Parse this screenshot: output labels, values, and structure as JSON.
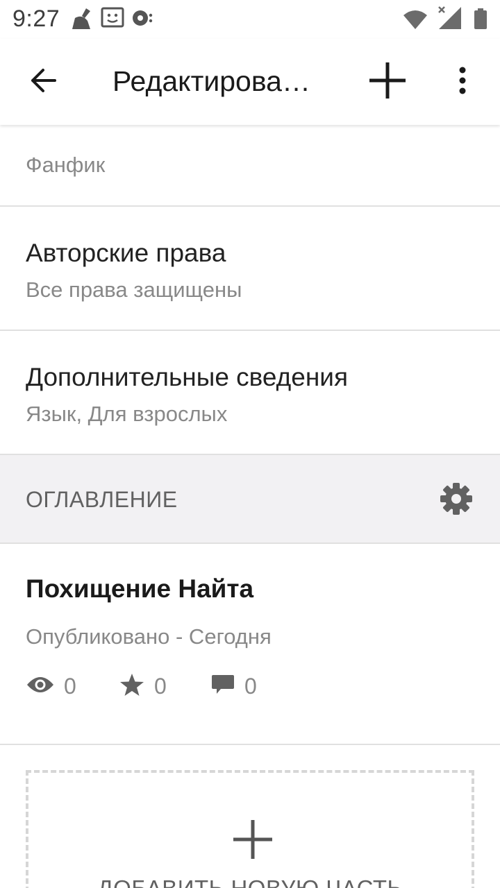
{
  "status_bar": {
    "time": "9:27",
    "left_icons": [
      "cleaner-icon",
      "face-card-icon",
      "sync-icon"
    ],
    "right_icons": [
      "wifi-icon",
      "signal-icon",
      "battery-icon"
    ]
  },
  "app_bar": {
    "title": "Редактирова…",
    "icons": [
      "back-arrow-icon",
      "plus-icon",
      "more-vert-icon"
    ]
  },
  "details": {
    "genre": "Фанфик",
    "copyright_title": "Авторские права",
    "copyright_value": "Все права защищены",
    "extra_title": "Дополнительные сведения",
    "extra_value": "Язык, Для взрослых"
  },
  "toc": {
    "label": "ОГЛАВЛЕНИЕ",
    "icon": "gear-icon"
  },
  "part": {
    "title": "Похищение Найта",
    "status": "Опубликовано - Сегодня",
    "views": "0",
    "votes": "0",
    "comments": "0"
  },
  "add_part": {
    "label": "ДОБАВИТЬ НОВУЮ ЧАСТЬ",
    "icon": "plus-icon"
  },
  "colors": {
    "text_primary": "#1a1a1a",
    "text_secondary": "#888888",
    "section_bg": "#f2f1f3",
    "divider": "#e0e0e0"
  }
}
